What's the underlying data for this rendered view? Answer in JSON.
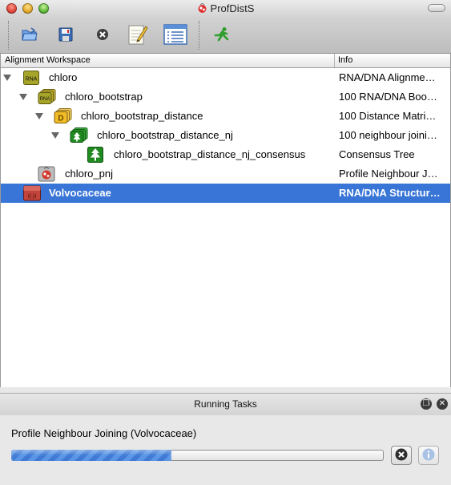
{
  "window": {
    "title": "ProfDistS"
  },
  "toolbar": {
    "buttons": [
      {
        "icon": "open-folder-icon"
      },
      {
        "icon": "save-disk-icon"
      },
      {
        "icon": "remove-icon"
      },
      {
        "icon": "edit-notepad-icon"
      },
      {
        "icon": "list-view-icon"
      },
      {
        "icon": "run-icon"
      }
    ]
  },
  "table": {
    "headers": {
      "workspace": "Alignment Workspace",
      "info": "Info"
    },
    "rows": [
      {
        "label": "chloro",
        "info": "RNA/DNA Alignme…",
        "icon": "rna-alignment-icon",
        "icon_text": "RNA",
        "expanded": true
      },
      {
        "label": "chloro_bootstrap",
        "info": "100 RNA/DNA Boo…",
        "icon": "rna-bootstrap-stack-icon",
        "icon_text": "RNA",
        "expanded": true
      },
      {
        "label": "chloro_bootstrap_distance",
        "info": "100 Distance Matri…",
        "icon": "distance-matrix-stack-icon",
        "icon_text": "D",
        "expanded": true
      },
      {
        "label": "chloro_bootstrap_distance_nj",
        "info": "100 neighbour joini…",
        "icon": "tree-stack-icon",
        "expanded": true
      },
      {
        "label": "chloro_bootstrap_distance_nj_consensus",
        "info": "Consensus Tree",
        "icon": "consensus-tree-icon"
      },
      {
        "label": "chloro_pnj",
        "info": "Profile Neighbour J…",
        "icon": "profile-nj-icon"
      },
      {
        "label": "Volvocaceae",
        "info": "RNA/DNA Structur…",
        "icon": "rna-structure-icon",
        "icon_text": "((.))",
        "selected": true
      }
    ]
  },
  "tasks": {
    "title": "Running Tasks",
    "task_name": "Profile Neighbour Joining (Volvocaceae)",
    "progress_fraction": 0.43
  },
  "colors": {
    "selection": "#3875d7",
    "progress": "#4a86dc"
  }
}
